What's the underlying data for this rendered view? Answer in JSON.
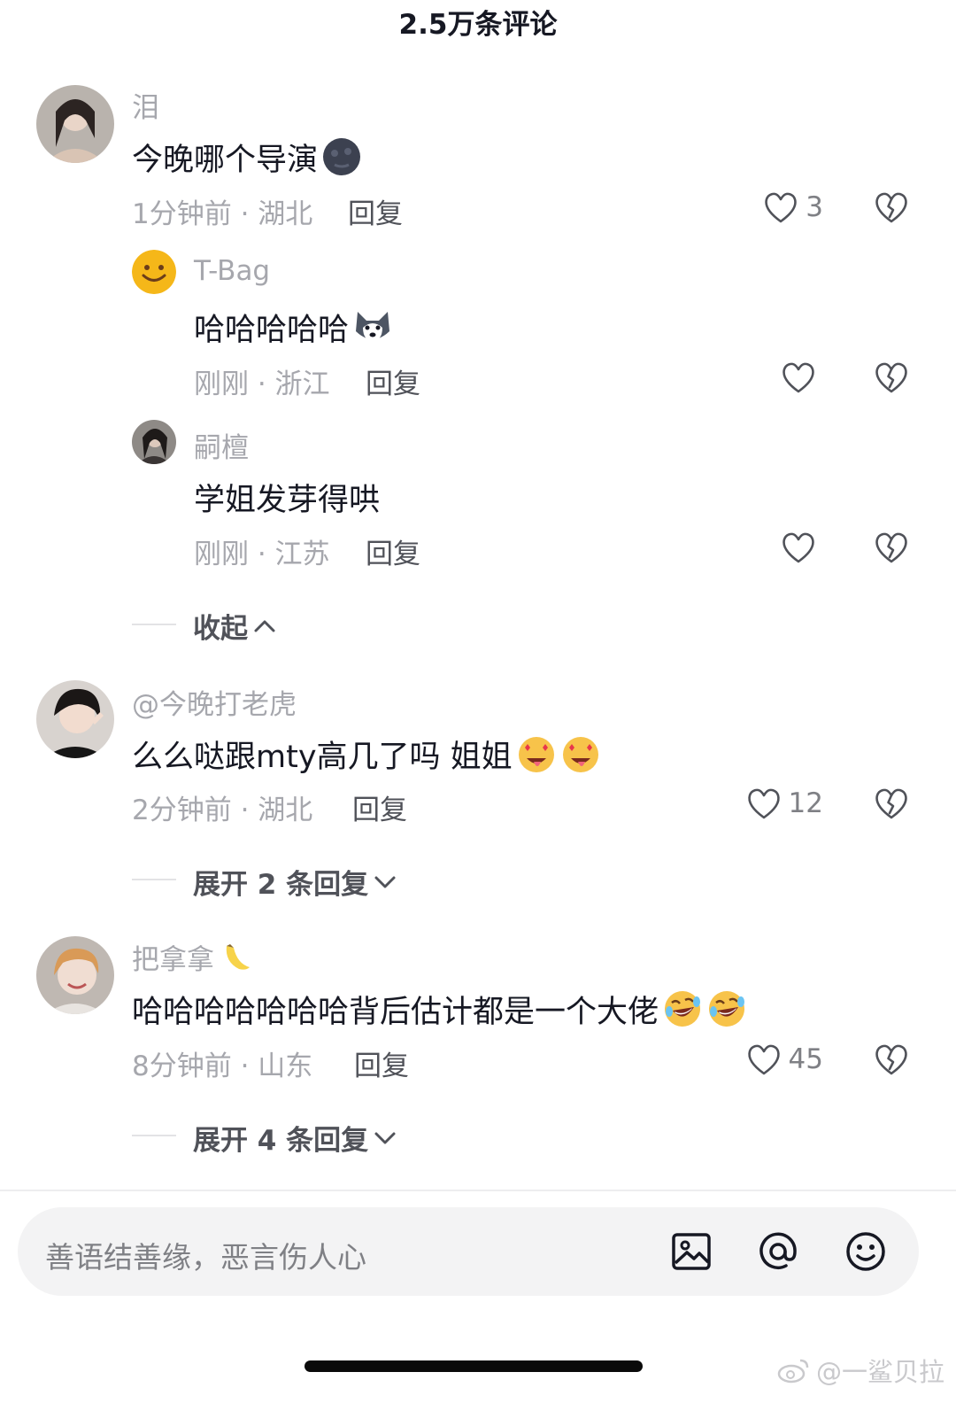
{
  "header": {
    "title": "2.5万条评论"
  },
  "comments": [
    {
      "username": "泪",
      "content": "今晚哪个导演",
      "content_emoji": "new-moon-face-emoji",
      "time": "1分钟前 · 湖北",
      "reply_label": "回复",
      "likes": "3"
    },
    {
      "username": "T-Bag",
      "content": "哈哈哈哈哈",
      "content_emoji": "husky-dog-emoji",
      "time": "刚刚 · 浙江",
      "reply_label": "回复",
      "likes": ""
    },
    {
      "username": "嗣檀",
      "content": "学姐发芽得哄",
      "time": "刚刚 · 江苏",
      "reply_label": "回复",
      "likes": ""
    },
    {
      "username": "@今晚打老虎",
      "content": "么么哒跟mty高几了吗 姐姐",
      "content_emoji": "star-struck-tongue-emoji",
      "time": "2分钟前 · 湖北",
      "reply_label": "回复",
      "likes": "12"
    },
    {
      "username": "把拿拿",
      "username_emoji": "banana-emoji",
      "content": "哈哈哈哈哈哈哈背后估计都是一个大佬",
      "content_emoji": "rolling-laughing-emoji",
      "time": "8分钟前 · 山东",
      "reply_label": "回复",
      "likes": "45"
    }
  ],
  "toggles": {
    "collapse": "收起",
    "expand_2": "展开 2 条回复",
    "expand_4": "展开 4 条回复"
  },
  "input": {
    "placeholder": "善语结善缘，恶言伤人心"
  },
  "watermark": {
    "text": "@一鲨贝拉"
  },
  "colors": {
    "text_primary": "#161823",
    "text_secondary": "#a6a7ad",
    "reply": "#505259",
    "input_bg": "#f3f3f4"
  }
}
